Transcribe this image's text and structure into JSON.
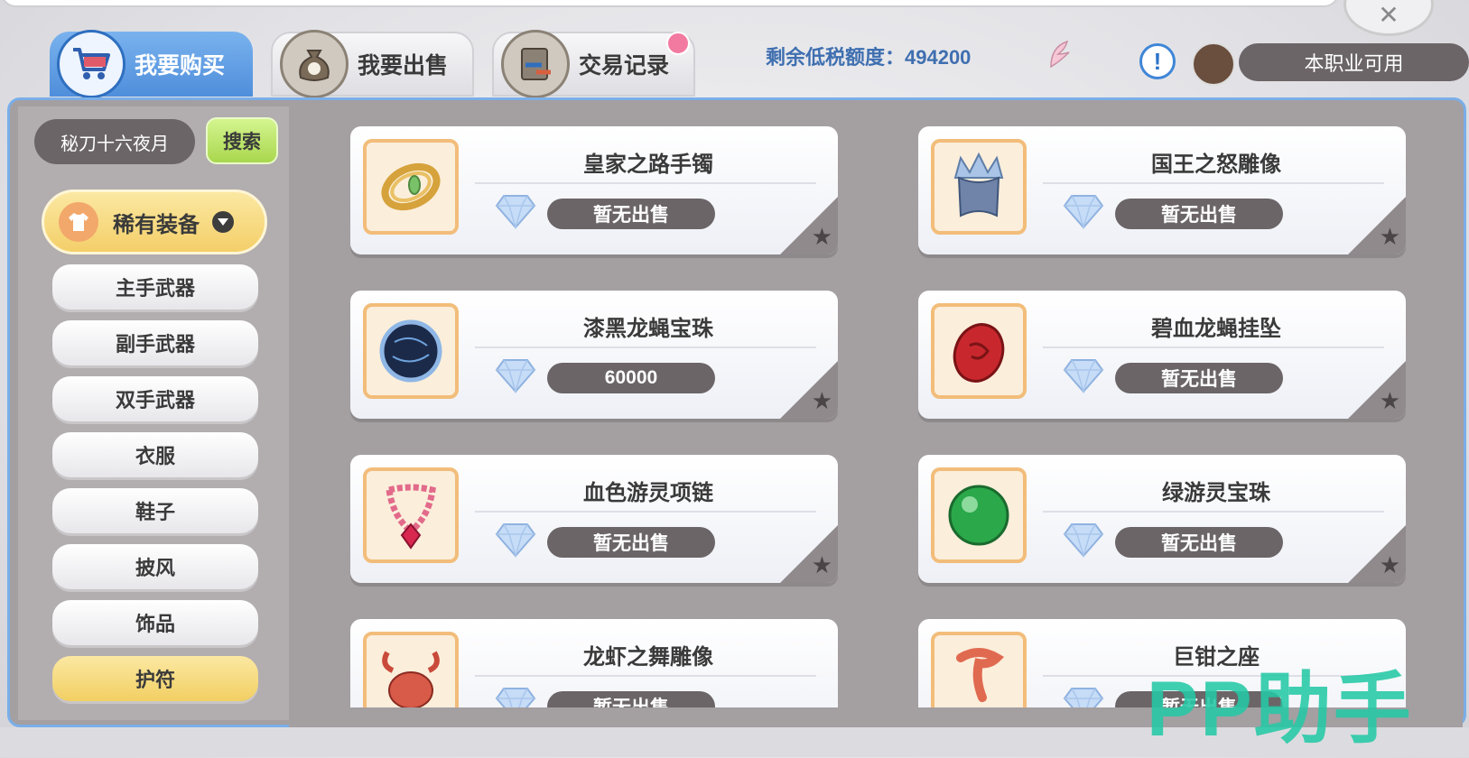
{
  "tabs": [
    {
      "label": "我要购买",
      "active": true,
      "icon": "shopping-cart-icon"
    },
    {
      "label": "我要出售",
      "active": false,
      "icon": "money-bag-icon"
    },
    {
      "label": "交易记录",
      "active": false,
      "icon": "trade-record-icon"
    }
  ],
  "header": {
    "tax_label": "剩余低税额度：494200",
    "class_filter": "本职业可用",
    "info_icon": "!"
  },
  "sidebar": {
    "search_value": "秘刀十六夜月",
    "search_button": "搜索",
    "category": "稀有装备",
    "items": [
      "主手武器",
      "副手武器",
      "双手武器",
      "衣服",
      "鞋子",
      "披风",
      "饰品",
      "护符"
    ],
    "active_item": "护符"
  },
  "listings": [
    {
      "name": "皇家之路手镯",
      "price": "暂无出售",
      "icon": "bracelet-icon"
    },
    {
      "name": "国王之怒雕像",
      "price": "暂无出售",
      "icon": "crown-statue-icon"
    },
    {
      "name": "漆黑龙蝇宝珠",
      "price": "60000",
      "icon": "dark-orb-icon"
    },
    {
      "name": "碧血龙蝇挂坠",
      "price": "暂无出售",
      "icon": "red-pendant-icon"
    },
    {
      "name": "血色游灵项链",
      "price": "暂无出售",
      "icon": "necklace-icon"
    },
    {
      "name": "绿游灵宝珠",
      "price": "暂无出售",
      "icon": "green-orb-icon"
    },
    {
      "name": "龙虾之舞雕像",
      "price": "暂无出售",
      "icon": "lobster-statue-icon"
    },
    {
      "name": "巨钳之座",
      "price": "暂无出售",
      "icon": "claw-icon"
    }
  ],
  "watermark": "PP助手",
  "colors": {
    "accent_blue": "#4f8edb",
    "panel_bg": "#a49fa1",
    "price_pill": "#6b6567",
    "active_yellow": "#f4cf69",
    "watermark": "#25c9a6"
  }
}
